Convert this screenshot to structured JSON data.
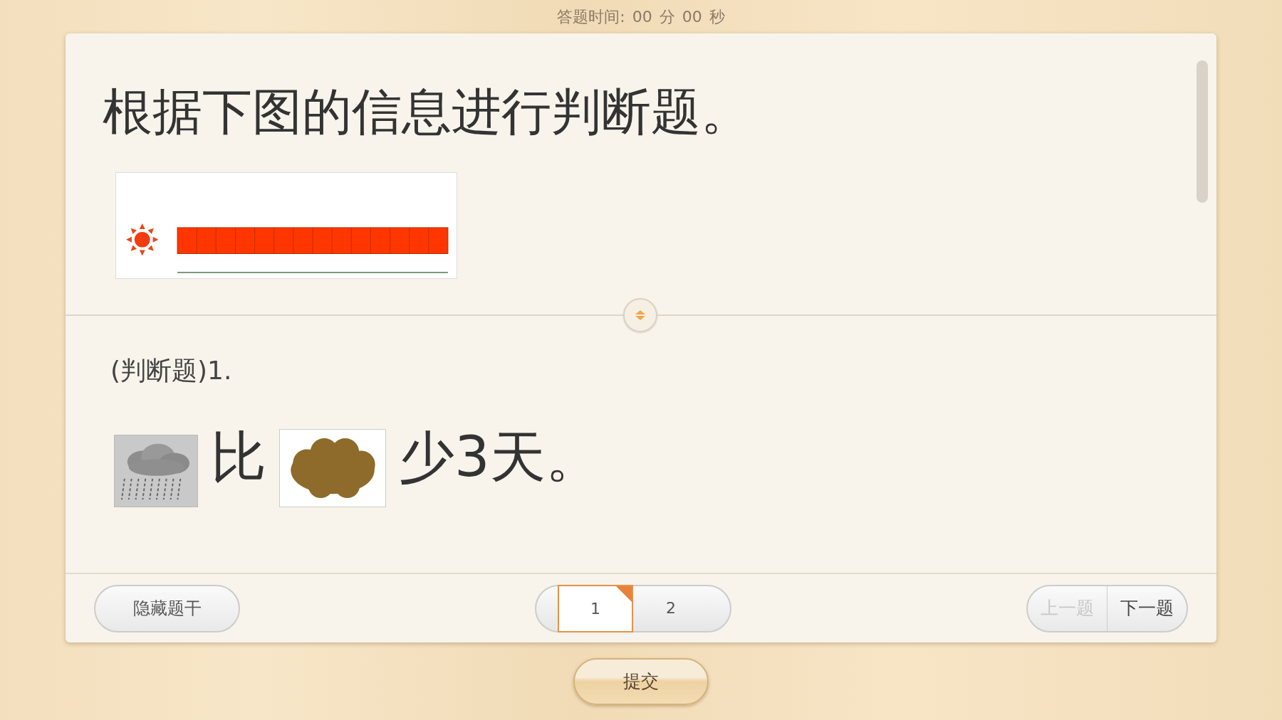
{
  "timer": {
    "label": "答题时间:",
    "minutes": "00",
    "minutes_unit": "分",
    "seconds": "00",
    "seconds_unit": "秒"
  },
  "stem": {
    "title": "根据下图的信息进行判断题。"
  },
  "question": {
    "label": "(判断题)1.",
    "parts": [
      {
        "kind": "rain"
      },
      {
        "kind": "text",
        "text": "比"
      },
      {
        "kind": "cloud"
      },
      {
        "kind": "text",
        "text": "少3天。"
      }
    ]
  },
  "footer": {
    "hide_button": "隐藏题干",
    "pages": [
      {
        "label": "1",
        "selected": true
      },
      {
        "label": "2",
        "selected": false
      }
    ],
    "prev": {
      "label": "上一题",
      "disabled": true
    },
    "next": {
      "label": "下一题",
      "disabled": false
    }
  },
  "submit": "提交"
}
